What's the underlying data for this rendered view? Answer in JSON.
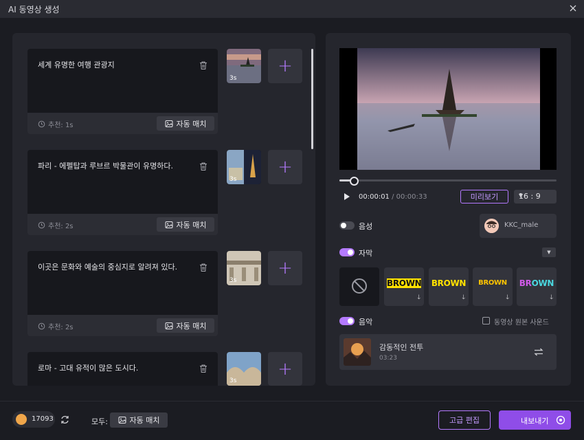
{
  "window": {
    "title": "AI 동영상 생성"
  },
  "scenes": [
    {
      "text": "세계 유명한 여행 관광지",
      "recommend": "추천: 1s",
      "duration": "3s",
      "auto_match": "자동 매치"
    },
    {
      "text": "파리 - 에펠탑과 루브르 박물관이 유명하다.",
      "recommend": "추천: 2s",
      "duration": "3s",
      "auto_match": "자동 매치"
    },
    {
      "text": "이곳은 문화와 예술의 중심지로 알려져 있다.",
      "recommend": "추천: 2s",
      "duration": "3s",
      "auto_match": "자동 매치"
    },
    {
      "text": "로마 - 고대 유적이 많은 도시다.",
      "recommend": "",
      "duration": "3s",
      "auto_match": ""
    }
  ],
  "player": {
    "current_time": "00:00:01",
    "separator": " / ",
    "total_time": "00:00:33",
    "progress": 0.06,
    "preview_label": "미리보기",
    "aspect_ratio": "16 : 9"
  },
  "voice": {
    "label": "음성",
    "enabled": false,
    "voice_name": "KKC_male"
  },
  "subtitle": {
    "label": "자막",
    "enabled": true,
    "styles": [
      {
        "name": "none",
        "text": ""
      },
      {
        "name": "brown-yellow-box",
        "text": "BROWN"
      },
      {
        "name": "brown-yellow",
        "text": "BROWN"
      },
      {
        "name": "brown-orange",
        "text": "BROWN"
      },
      {
        "name": "brown-gradient",
        "text": "BROWN"
      }
    ]
  },
  "music": {
    "label": "음악",
    "enabled": true,
    "original_sound_label": "동영상 원본 사운드",
    "original_sound_checked": false,
    "track_title": "감동적인 전투",
    "track_duration": "03:23"
  },
  "footer": {
    "credits": "17093",
    "all_label": "모두:",
    "auto_match_all": "자동 매치",
    "advanced_edit": "고급 편집",
    "export": "내보내기"
  },
  "colors": {
    "accent": "#b47aff",
    "export_bg": "#8f4de8",
    "panel": "#25262d",
    "background": "#1b1c22"
  }
}
